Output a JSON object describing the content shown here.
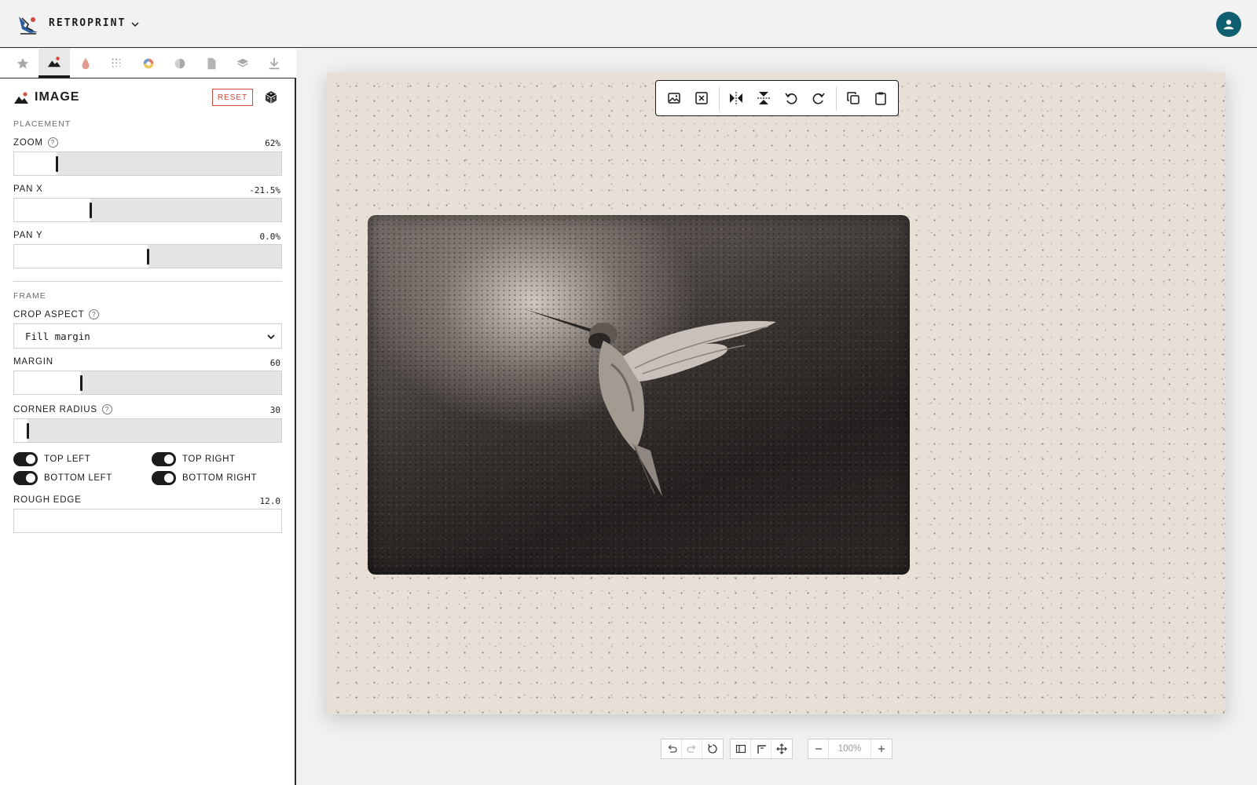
{
  "app": {
    "name": "RETROPRINT"
  },
  "tabs": [
    {
      "icon": "star-icon"
    },
    {
      "icon": "image-icon"
    },
    {
      "icon": "drop-icon"
    },
    {
      "icon": "halftone-icon"
    },
    {
      "icon": "color-wheel-icon"
    },
    {
      "icon": "contrast-icon"
    },
    {
      "icon": "paper-icon"
    },
    {
      "icon": "layers-icon"
    },
    {
      "icon": "download-icon"
    }
  ],
  "panel": {
    "title": "IMAGE",
    "reset_label": "RESET",
    "placement_label": "PLACEMENT",
    "zoom": {
      "label": "ZOOM",
      "value": "62%",
      "level": 0.16
    },
    "pan_x": {
      "label": "PAN X",
      "value": "-21.5%",
      "level": 0.285
    },
    "pan_y": {
      "label": "PAN Y",
      "value": "0.0%",
      "level": 0.5
    },
    "frame_label": "FRAME",
    "crop_aspect": {
      "label": "CROP ASPECT",
      "selected": "Fill margin"
    },
    "margin": {
      "label": "MARGIN",
      "value": "60",
      "level": 0.25
    },
    "corner_radius": {
      "label": "CORNER RADIUS",
      "value": "30",
      "level": 0.05
    },
    "corners": {
      "top_left": "TOP LEFT",
      "top_right": "TOP RIGHT",
      "bottom_left": "BOTTOM LEFT",
      "bottom_right": "BOTTOM RIGHT"
    },
    "rough_edge": {
      "label": "ROUGH EDGE",
      "value": "12.0"
    }
  },
  "canvas_toolbar": {
    "buttons": [
      "replace-image",
      "remove-image",
      "flip-horizontal",
      "flip-vertical",
      "rotate-left",
      "rotate-right",
      "copy",
      "paste"
    ]
  },
  "bottom_bar": {
    "zoom": "100%"
  },
  "colors": {
    "accent_reset": "#d24a3c",
    "avatar": "#0f5f71",
    "paper": "#e8e0d6"
  }
}
